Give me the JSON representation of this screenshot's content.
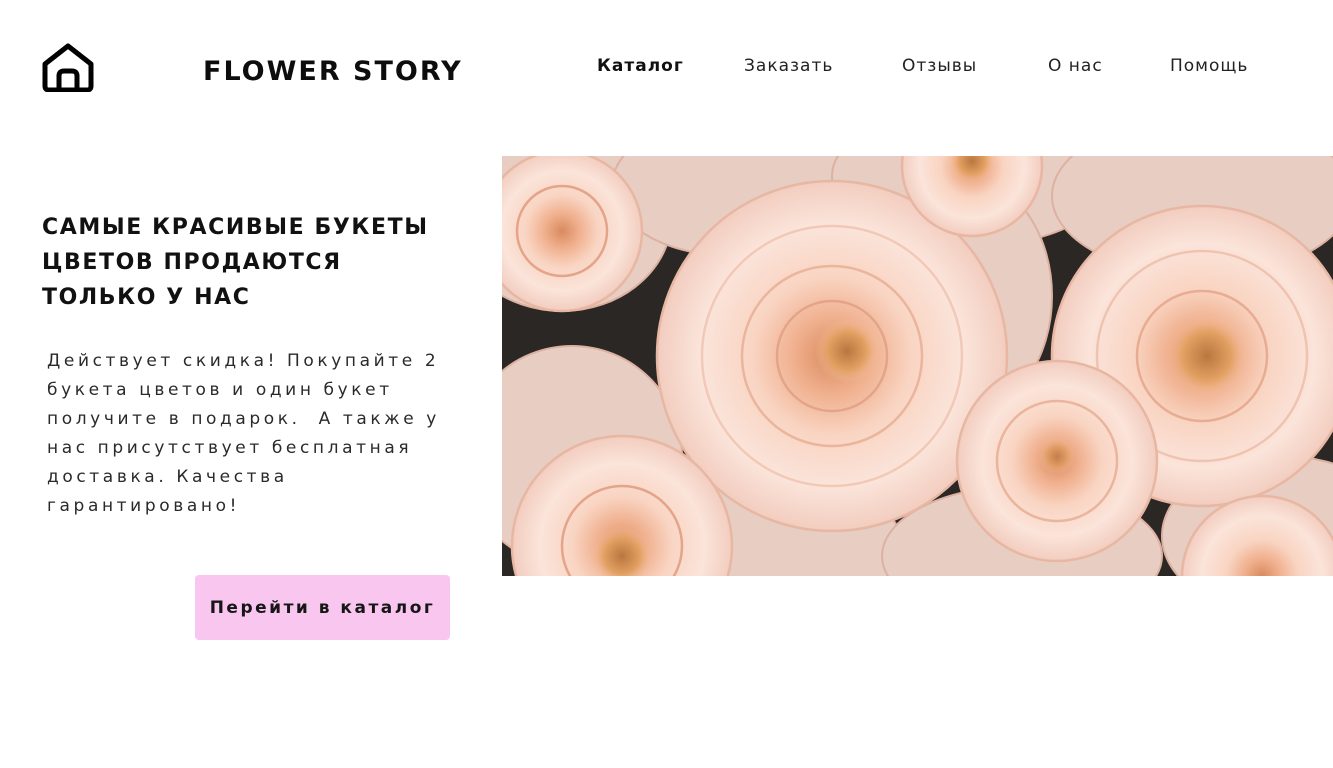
{
  "header": {
    "home_icon": "home-icon",
    "brand": "FLOWER STORY",
    "nav": [
      {
        "label": "Каталог",
        "active": true
      },
      {
        "label": "Заказать",
        "active": false
      },
      {
        "label": "Отзывы",
        "active": false
      },
      {
        "label": "О нас",
        "active": false
      },
      {
        "label": "Помощь",
        "active": false
      }
    ]
  },
  "hero": {
    "headline_lines": [
      "САМЫЕ КРАСИВЫЕ БУКЕТЫ",
      "ЦВЕТОВ ПРОДАЮТСЯ",
      "ТОЛЬКО У НАС"
    ],
    "promo_lines": [
      "Действует скидка! Покупайте 2",
      "букета цветов и один букет",
      "получите в подарок.  А также у",
      "нас присутствует бесплатная",
      "доставка. Качества",
      "гарантировано!"
    ],
    "cta_label": "Перейти в каталог",
    "image": "roses-photo"
  },
  "colors": {
    "cta_background": "#f9c6ef",
    "text": "#111111",
    "rose_petal": "#f6d2c0",
    "rose_center": "#e8a17a"
  }
}
